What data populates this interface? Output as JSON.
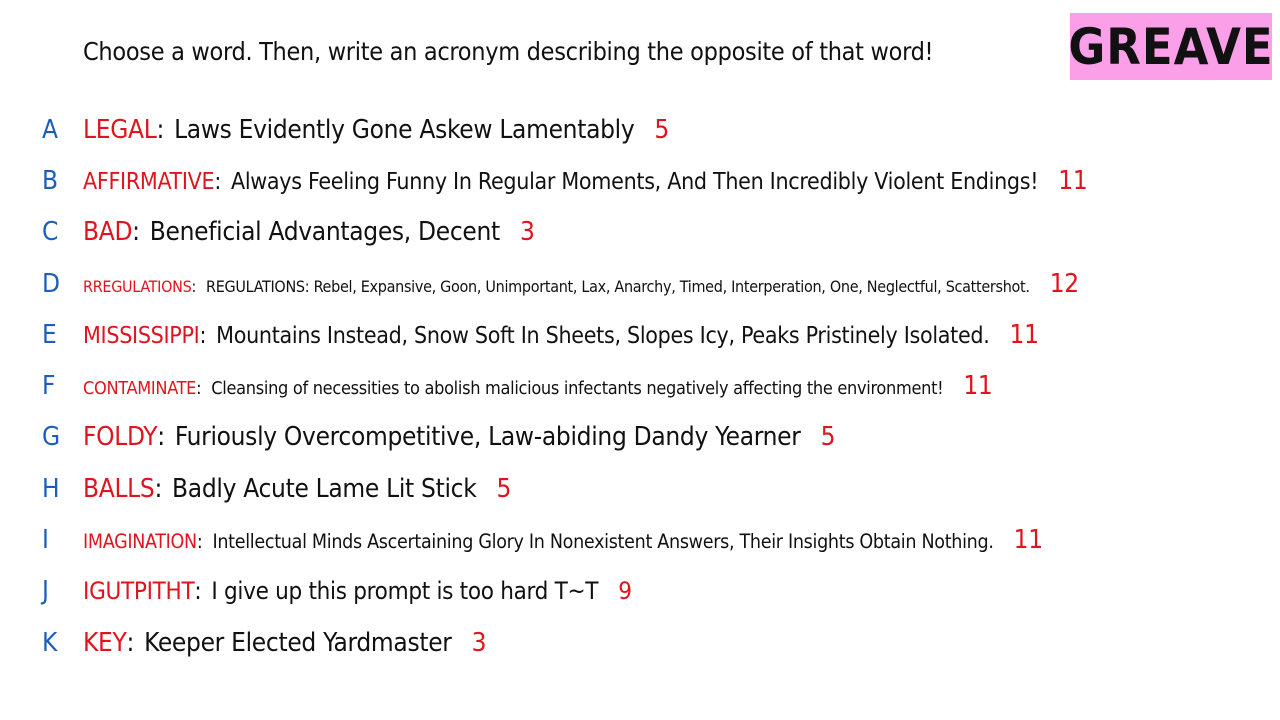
{
  "prompt": "Choose a word. Then, write an acronym describing the opposite of that word!",
  "player": {
    "name": "GREAVE",
    "badge_color": "#fb9fe9"
  },
  "colors": {
    "letter": "#1d5fb8",
    "word": "#e0141e",
    "count": "#e0141e",
    "text": "#111111"
  },
  "answers": [
    {
      "letter": "A",
      "word": "LEGAL",
      "acronym": "Laws Evidently Gone Askew Lamentably",
      "count": "5"
    },
    {
      "letter": "B",
      "word": "AFFIRMATIVE",
      "acronym": "Always Feeling Funny In Regular Moments, And Then Incredibly Violent Endings!",
      "count": "11"
    },
    {
      "letter": "C",
      "word": "BAD",
      "acronym": "Beneficial Advantages, Decent",
      "count": "3"
    },
    {
      "letter": "D",
      "word": "RREGULATIONS",
      "acronym": "REGULATIONS: Rebel, Expansive, Goon, Unimportant, Lax, Anarchy, Timed, Interperation, One, Neglectful, Scattershot.",
      "count": "12"
    },
    {
      "letter": "E",
      "word": "MISSISSIPPI",
      "acronym": "Mountains Instead, Snow Soft In Sheets, Slopes Icy, Peaks Pristinely Isolated.",
      "count": "11"
    },
    {
      "letter": "F",
      "word": "CONTAMINATE",
      "acronym": "Cleansing of necessities to abolish malicious infectants negatively affecting the environment!",
      "count": "11"
    },
    {
      "letter": "G",
      "word": "FOLDY",
      "acronym": "Furiously Overcompetitive, Law-abiding Dandy Yearner",
      "count": "5"
    },
    {
      "letter": "H",
      "word": "BALLS",
      "acronym": "Badly Acute Lame Lit Stick",
      "count": "5"
    },
    {
      "letter": "I",
      "word": "IMAGINATION",
      "acronym": "Intellectual Minds Ascertaining Glory In Nonexistent Answers, Their Insights Obtain Nothing.",
      "count": "11"
    },
    {
      "letter": "J",
      "word": "IGUTPITHT",
      "acronym": "I give up this prompt is too hard T~T",
      "count": "9"
    },
    {
      "letter": "K",
      "word": "KEY",
      "acronym": "Keeper Elected Yardmaster",
      "count": "3"
    }
  ]
}
